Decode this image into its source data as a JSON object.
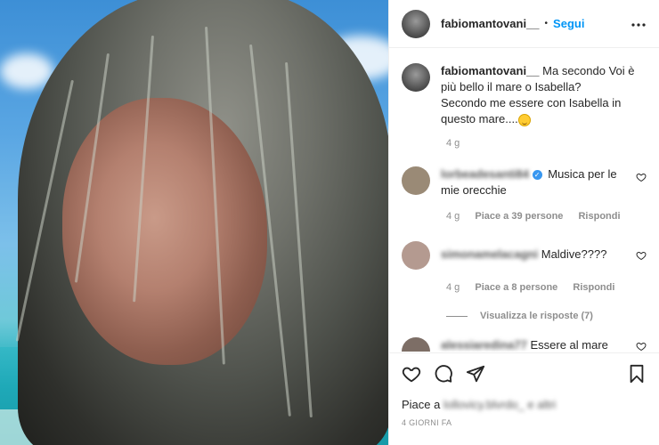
{
  "header": {
    "username": "fabiomantovani__",
    "dot": "•",
    "follow_label": "Segui",
    "more_label": "•••",
    "avatar_icon": "profile-avatar",
    "more_icon": "more-horizontal-icon"
  },
  "caption": {
    "username": "fabiomantovani__",
    "text_line1": "Ma secondo Voi è più bello il mare o Isabella?",
    "text_line2": "Secondo me essere con Isabella in questo mare....",
    "emoji_icon": "smiling-face-emoji",
    "age": "4 g"
  },
  "comments": [
    {
      "username": "lorbeadesanti84",
      "verified": true,
      "text": "Musica per le mie orecchie",
      "age": "4 g",
      "likes": "Piace a 39 persone",
      "reply_label": "Rispondi",
      "avatar_color": "#9a8a76"
    },
    {
      "username": "simonamelacagni",
      "verified": false,
      "text": "Maldive????",
      "age": "4 g",
      "likes": "Piace a 8 persone",
      "reply_label": "Rispondi",
      "view_replies": "Visualizza le risposte (7)",
      "avatar_color": "#b49a90"
    },
    {
      "username": "alessiaredina77",
      "verified": false,
      "text": "Essere al mare",
      "avatar_color": "#7d6e66"
    }
  ],
  "actions": {
    "like_icon": "heart-icon",
    "comment_icon": "comment-icon",
    "share_icon": "share-icon",
    "save_icon": "bookmark-icon",
    "likes_prefix": "Piace a",
    "likes_user": "lollovicy.blvrdo_ e altri",
    "timestamp": "4 GIORNI FA"
  },
  "colors": {
    "link": "#0095f6",
    "secondary_text": "#8e8e8e",
    "border": "#efefef"
  }
}
